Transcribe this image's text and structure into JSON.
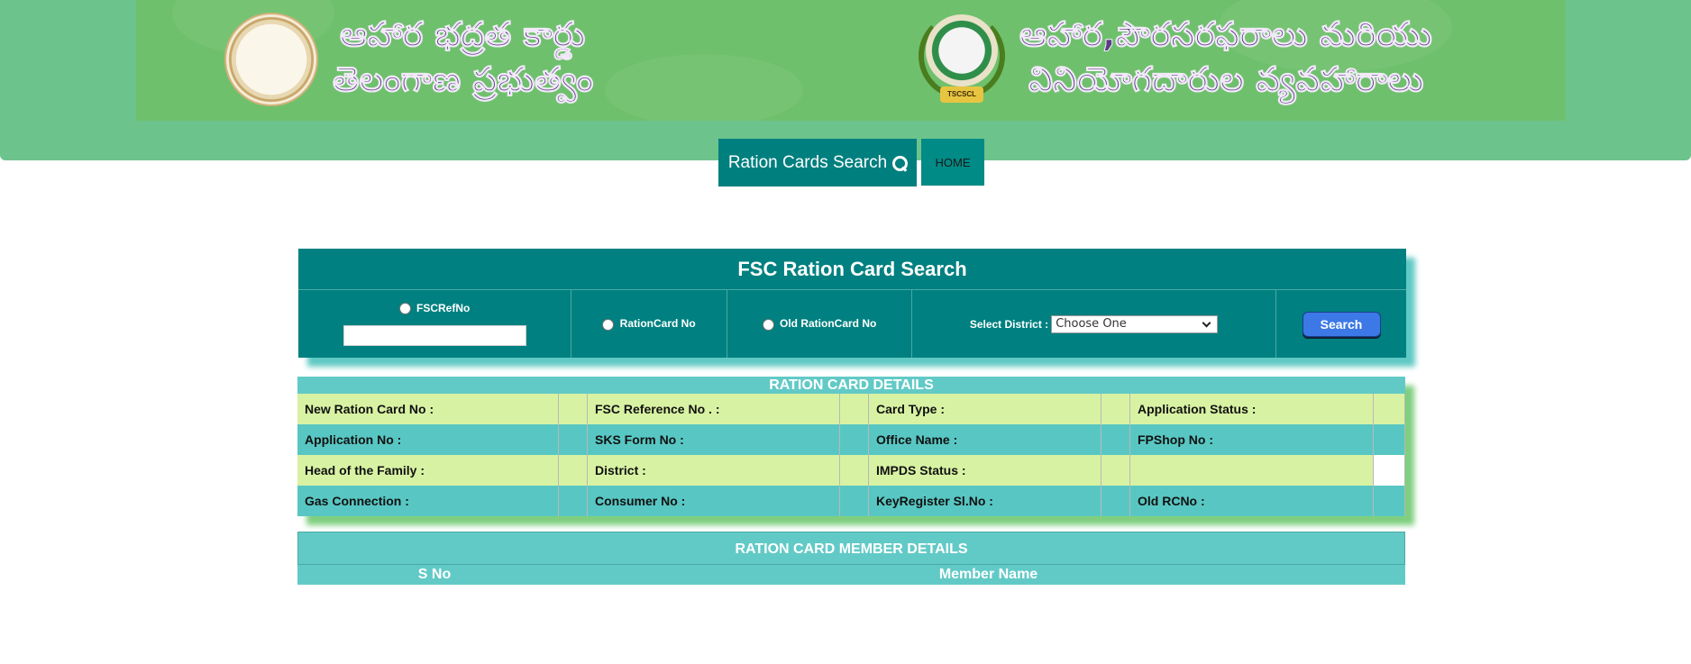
{
  "banner": {
    "left_title_line1": "ఆహార భద్రత కార్డు",
    "left_title_line2": "తెలంగాణ ప్రభుత్వం",
    "right_title_line1": "ఆహార,పౌరసరఫరాలు మరియు",
    "right_title_line2": "వినియోగదారుల వ్యవహారాలు",
    "right_emblem_ribbon": "TSCSCL"
  },
  "nav": {
    "search_label": "Ration Cards Search",
    "home_label": "HOME"
  },
  "search_panel": {
    "title": "FSC Ration Card Search",
    "radio_fsc_ref": "FSCRefNo",
    "radio_ration_card": "RationCard No",
    "radio_old_ration_card": "Old RationCard No",
    "district_label": "Select District :",
    "district_selected": "Choose One",
    "search_button": "Search"
  },
  "details": {
    "title": "RATION CARD DETAILS",
    "rows": [
      [
        "New Ration Card No :",
        "FSC Reference No . :",
        "Card Type :",
        "Application Status :"
      ],
      [
        "Application No :",
        "SKS Form No :",
        "Office Name :",
        "FPShop No :"
      ],
      [
        "Head of the Family :",
        "District :",
        "IMPDS Status :",
        ""
      ],
      [
        "Gas Connection :",
        "Consumer No :",
        "KeyRegister Sl.No :",
        "Old RCNo :"
      ]
    ]
  },
  "members": {
    "title": "RATION CARD MEMBER DETAILS",
    "col_sno": "S No",
    "col_name": "Member Name"
  },
  "colors": {
    "header_green": "#6dc38c",
    "banner_green": "#6fc06d",
    "teal": "#008080",
    "light_teal": "#62cac6",
    "light_green_row": "#d8f2a3",
    "search_button": "#3d79e6"
  }
}
